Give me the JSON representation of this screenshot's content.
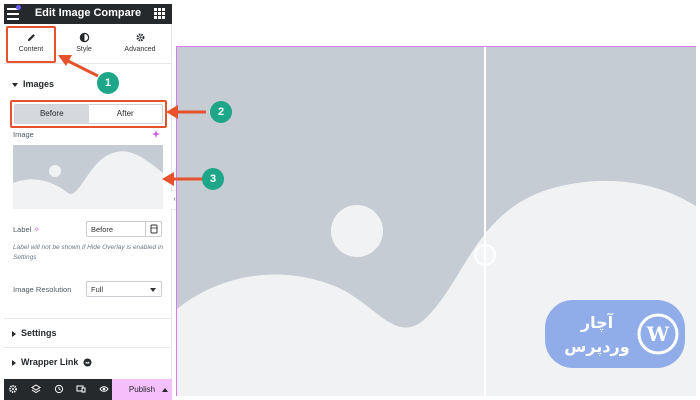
{
  "app": {
    "title": "Edit Image Compare"
  },
  "tabs": [
    {
      "label": "Content",
      "icon": "pencil-icon"
    },
    {
      "label": "Style",
      "icon": "half-circle-icon"
    },
    {
      "label": "Advanced",
      "icon": "gear-icon"
    }
  ],
  "images_section": {
    "title": "Images",
    "switch": {
      "before": "Before",
      "after": "After",
      "selected": "Before"
    },
    "image_label": "Image",
    "label_field": {
      "label": "Label",
      "value": "Before"
    },
    "note": "Label will not be shown if Hide Overlay is enabled in Settings",
    "resolution": {
      "label": "Image Resolution",
      "value": "Full"
    }
  },
  "settings_section": {
    "title": "Settings"
  },
  "wrapper_section": {
    "title": "Wrapper Link"
  },
  "footer": {
    "icons": [
      "settings-icon",
      "layers-icon",
      "history-icon",
      "responsive-icon",
      "preview-icon"
    ],
    "publish_label": "Publish"
  },
  "annotations": [
    {
      "number": "1"
    },
    {
      "number": "2"
    },
    {
      "number": "3"
    }
  ],
  "colors": {
    "annotation_red": "#e5522b",
    "badge_green": "#1ea689",
    "placeholder_gray": "#c6ccd3",
    "publish_pink": "#f4bffb",
    "dark_bar": "#26292c"
  },
  "watermark": {
    "text_line1": "آچار",
    "text_line2": "وردپرس"
  }
}
